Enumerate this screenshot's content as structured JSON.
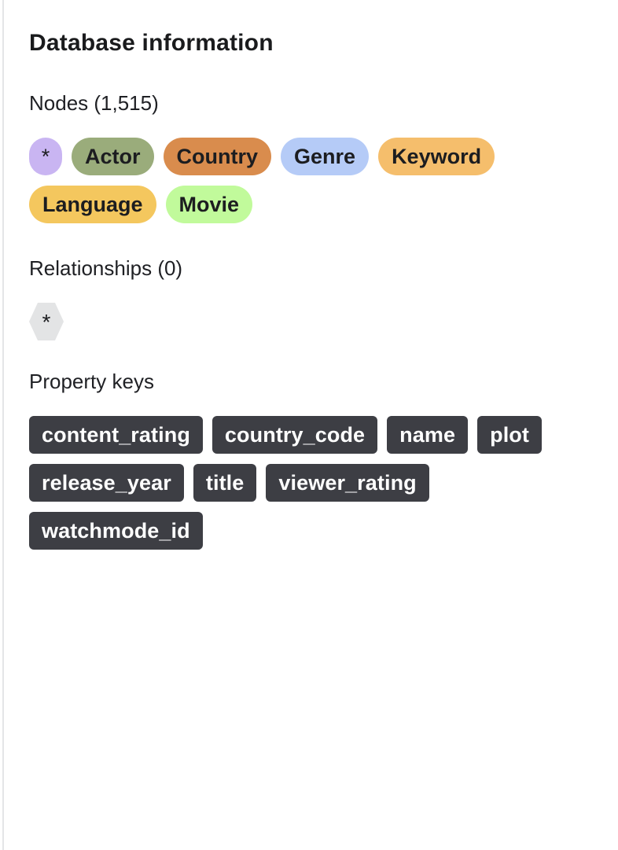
{
  "panel": {
    "title": "Database information"
  },
  "nodes": {
    "label": "Nodes (1,515)",
    "items": [
      {
        "label": "*",
        "color": "#c9b5f2"
      },
      {
        "label": "Actor",
        "color": "#9aac7b"
      },
      {
        "label": "Country",
        "color": "#d98c4d"
      },
      {
        "label": "Genre",
        "color": "#b5cbf7"
      },
      {
        "label": "Keyword",
        "color": "#f5be6c"
      },
      {
        "label": "Language",
        "color": "#f4c75e"
      },
      {
        "label": "Movie",
        "color": "#c1fa9b"
      }
    ]
  },
  "relationships": {
    "label": "Relationships (0)",
    "items": [
      {
        "label": "*",
        "color": "#e3e4e5"
      }
    ]
  },
  "property_keys": {
    "label": "Property keys",
    "items": [
      {
        "label": "content_rating"
      },
      {
        "label": "country_code"
      },
      {
        "label": "name"
      },
      {
        "label": "plot"
      },
      {
        "label": "release_year"
      },
      {
        "label": "title"
      },
      {
        "label": "viewer_rating"
      },
      {
        "label": "watchmode_id"
      }
    ]
  }
}
